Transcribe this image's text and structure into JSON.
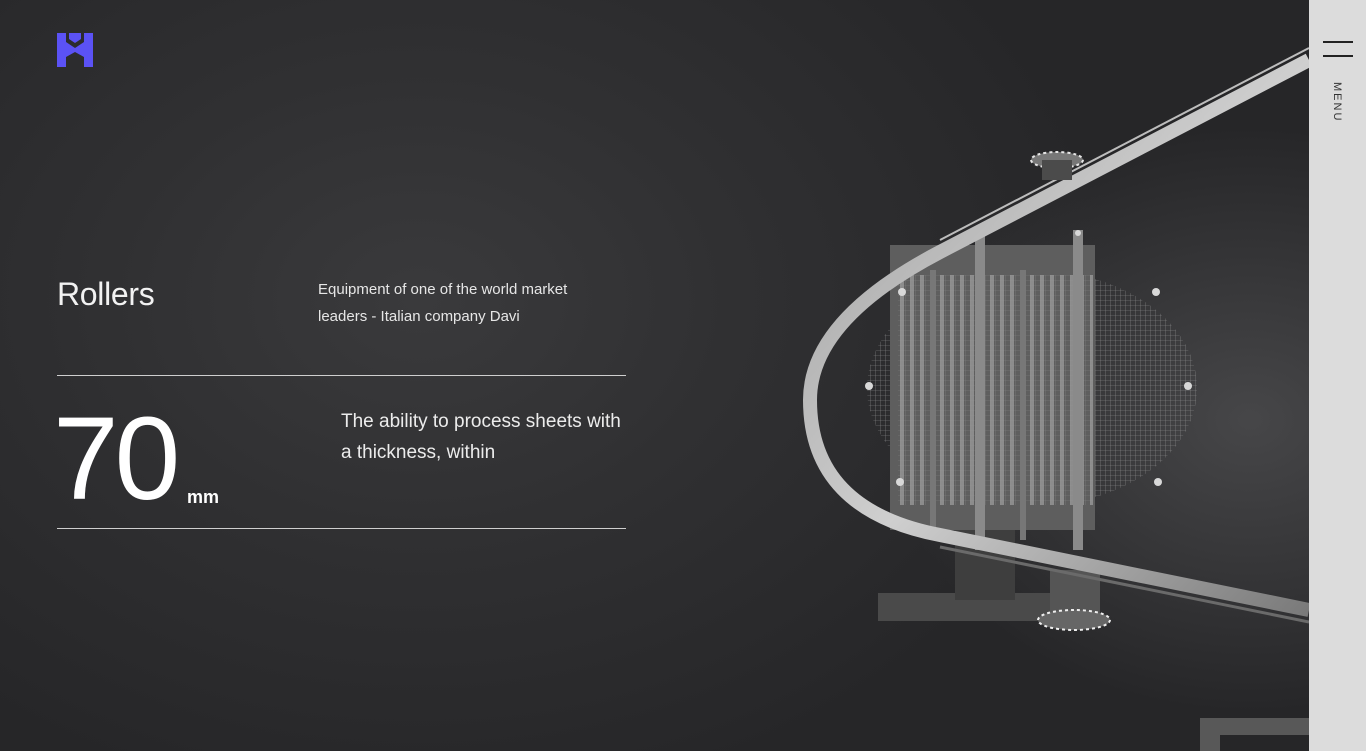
{
  "brand": {
    "logo_letter": "M",
    "accent_color": "#5b52f5"
  },
  "section": {
    "title": "Rollers",
    "description": "Equipment of one of the world market leaders - Italian company Davi"
  },
  "stat": {
    "value": "70",
    "unit": "mm",
    "description": "The ability to process sheets with a thickness, within"
  },
  "menu": {
    "label": "MENU",
    "icon": "hamburger-icon"
  },
  "colors": {
    "background": "#2c2c2e",
    "panel": "#dcdcdc",
    "text": "#ffffff"
  }
}
